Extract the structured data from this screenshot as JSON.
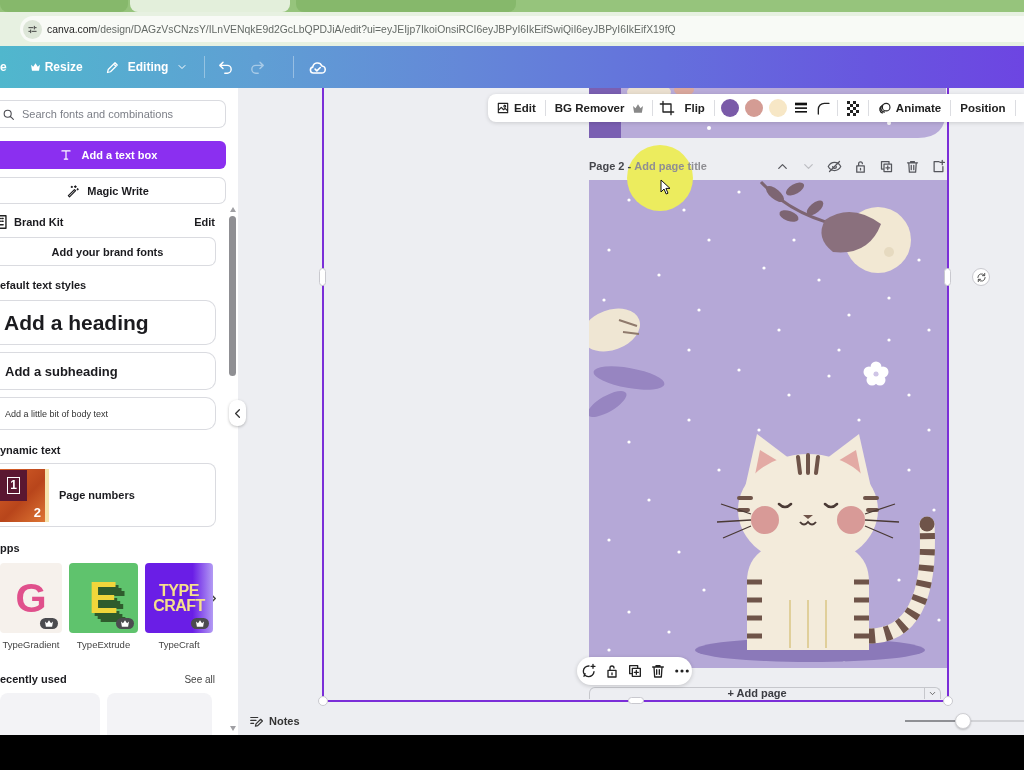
{
  "browser": {
    "tabs": [
      {
        "selected": false
      },
      {
        "selected": true
      },
      {
        "selected": false
      }
    ],
    "address": {
      "host": "canva.com",
      "path": "/design/DAGzVsCNzsY/ILnVENqkE9d2GcLbQPDJiA/edit?ui=eyJEIjp7IkoiOnsiRCI6eyJBPyI6IkEifSwiQiI6eyJBPyI6IkEifX19fQ"
    }
  },
  "topbar": {
    "menu_fragment": "e",
    "resize": {
      "label": "Resize",
      "premium": true
    },
    "mode": {
      "label": "Editing"
    },
    "history": [
      {
        "kind": "undo",
        "disabled": false
      },
      {
        "kind": "redo",
        "disabled": true
      }
    ]
  },
  "panel": {
    "search": {
      "placeholder": "Search fonts and combinations"
    },
    "primary_button": "Add a text box",
    "magic_button": "Magic Write",
    "brand_kit": {
      "title": "Brand Kit",
      "action": "Edit",
      "button": "Add your brand fonts"
    },
    "text_styles": {
      "title": "efault text styles",
      "items": [
        {
          "kind": "heading",
          "label": "Add a heading"
        },
        {
          "kind": "subheading",
          "label": "Add a subheading"
        },
        {
          "kind": "body",
          "label": "Add a little bit of body text"
        }
      ]
    },
    "dynamic_text": {
      "title": "ynamic text",
      "items": [
        {
          "label": "Page numbers",
          "thumb_numbers": [
            "1",
            "2"
          ]
        }
      ]
    },
    "apps": {
      "title": "pps",
      "items": [
        {
          "kind": "gradient",
          "logo": "G",
          "name": "TypeGradient",
          "premium": true
        },
        {
          "kind": "extrude",
          "logo": "E",
          "name": "TypeExtrude",
          "premium": true
        },
        {
          "kind": "craft",
          "logo": "TYPE CRAFT",
          "name": "TypeCraft",
          "premium": true
        }
      ]
    },
    "recent": {
      "title": "ecently used",
      "action": "See all"
    }
  },
  "canvas": {
    "toolbar": [
      {
        "kind": "edit",
        "label": "Edit"
      },
      {
        "kind": "divider"
      },
      {
        "kind": "bg_remover",
        "label": "BG Remover",
        "premium": true
      },
      {
        "kind": "divider"
      },
      {
        "kind": "crop"
      },
      {
        "kind": "flip",
        "label": "Flip"
      },
      {
        "kind": "divider"
      },
      {
        "kind": "swatch",
        "color": "#7a5aa8"
      },
      {
        "kind": "swatch",
        "color": "#d49c94"
      },
      {
        "kind": "swatch",
        "color": "#f7e7c6"
      },
      {
        "kind": "border"
      },
      {
        "kind": "corner"
      },
      {
        "kind": "divider"
      },
      {
        "kind": "transparency"
      },
      {
        "kind": "divider"
      },
      {
        "kind": "animate",
        "label": "Animate"
      },
      {
        "kind": "divider"
      },
      {
        "kind": "position",
        "label": "Position"
      },
      {
        "kind": "divider"
      }
    ],
    "page_header": {
      "prefix": "Page 2 - ",
      "placeholder": "Add page title",
      "actions": [
        {
          "kind": "up",
          "disabled": false
        },
        {
          "kind": "down",
          "disabled": true
        },
        {
          "kind": "hide",
          "disabled": false
        },
        {
          "kind": "lock",
          "disabled": false
        },
        {
          "kind": "duplicate",
          "disabled": false
        },
        {
          "kind": "delete",
          "disabled": false
        },
        {
          "kind": "add",
          "disabled": false
        }
      ]
    },
    "page_tools": [
      {
        "kind": "comment"
      },
      {
        "kind": "lock"
      },
      {
        "kind": "duplicate"
      },
      {
        "kind": "delete"
      },
      {
        "kind": "more"
      }
    ],
    "add_page": "+ Add page"
  },
  "footer": {
    "notes": "Notes",
    "zoom": {
      "level": 0.49
    }
  }
}
